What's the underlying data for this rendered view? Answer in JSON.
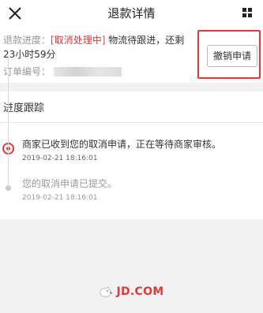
{
  "header": {
    "title": "退款详情",
    "close_icon": "close-icon",
    "more_icon": "grid-menu-icon"
  },
  "info": {
    "progress_label": "退款进度：",
    "status_tag": "[取消处理中]",
    "status_text": "物流待跟进，还剩23小时59分",
    "order_label": "订单编号：",
    "cancel_button": "撤销申请"
  },
  "progress": {
    "title": "进度跟踪",
    "steps": [
      {
        "desc": "商家已收到您的取消申请，正在等待商家审核。",
        "time": "2019-02-21 18:16:01",
        "active": true
      },
      {
        "desc": "您的取消申请已提交。",
        "time": "2019-02-21 18:16:01",
        "active": false
      }
    ]
  },
  "footer": {
    "logo_text": "JD.COM",
    "logo_icon": "jd-dog-icon"
  },
  "colors": {
    "accent": "#e4393c",
    "muted": "#999999",
    "background": "#f2f2f2"
  }
}
